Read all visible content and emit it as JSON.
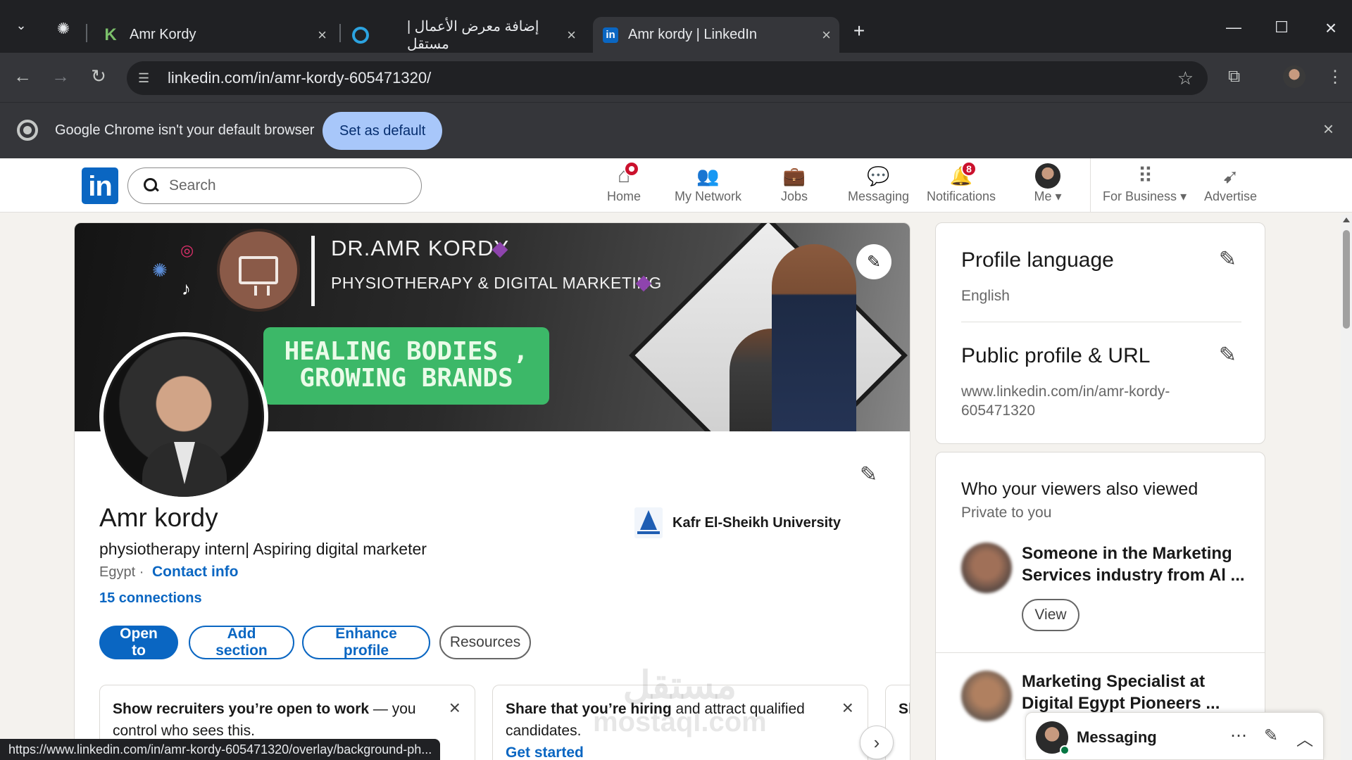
{
  "browser": {
    "tabs": [
      {
        "label": "Amr Kordy",
        "icon": "k-logo-icon"
      },
      {
        "label": "إضافة معرض الأعمال | مستقل",
        "icon": "mostaql-icon"
      },
      {
        "label": "Amr kordy | LinkedIn",
        "icon": "linkedin-icon"
      }
    ],
    "url": "linkedin.com/in/amr-kordy-605471320/",
    "infobar_message": "Google Chrome isn't your default browser",
    "set_default_label": "Set as default",
    "status_url": "https://www.linkedin.com/in/amr-kordy-605471320/overlay/background-ph..."
  },
  "header": {
    "search_placeholder": "Search",
    "nav": [
      {
        "label": "Home",
        "icon": "home-icon"
      },
      {
        "label": "My Network",
        "icon": "network-icon"
      },
      {
        "label": "Jobs",
        "icon": "briefcase-icon"
      },
      {
        "label": "Messaging",
        "icon": "chat-icon"
      },
      {
        "label": "Notifications",
        "icon": "bell-icon",
        "badge": "8"
      },
      {
        "label": "Me",
        "icon": "avatar"
      },
      {
        "label": "For Business",
        "icon": "grid-icon"
      },
      {
        "label": "Advertise",
        "icon": "compass-icon"
      }
    ]
  },
  "banner": {
    "title": "DR.AMR KORDY",
    "subtitle": "PHYSIOTHERAPY & DIGITAL MARKETING",
    "slogan_line1": "HEALING BODIES ,",
    "slogan_line2": "GROWING BRANDS",
    "accent": "#3cb868"
  },
  "profile": {
    "name": "Amr kordy",
    "headline": "physiotherapy intern| Aspiring digital marketer",
    "location": "Egypt",
    "contact_info": "Contact info",
    "connections": "15 connections",
    "education": "Kafr El-Sheikh University",
    "buttons": {
      "open_to": "Open to",
      "add_section": "Add section",
      "enhance_profile": "Enhance profile",
      "resources": "Resources"
    }
  },
  "promos": [
    {
      "bold": "Show recruiters you’re open to work",
      "rest": " — you control who sees this."
    },
    {
      "bold": "Share that you’re hiring",
      "rest": " and attract qualified candidates.",
      "link": "Get started"
    },
    {
      "bold": "Sh",
      "rest": "",
      "link": ""
    }
  ],
  "sidebar": {
    "profile_language_title": "Profile language",
    "profile_language_value": "English",
    "public_profile_title": "Public profile & URL",
    "public_profile_line1": "www.linkedin.com/in/amr-kordy-",
    "public_profile_line2": "605471320",
    "viewers_title": "Who your viewers also viewed",
    "viewers_sub": "Private to you",
    "viewers": [
      {
        "line1": "Someone in the Marketing",
        "line2": "Services industry from Al ...",
        "button": "View"
      },
      {
        "line1": "Marketing Specialist at",
        "line2": "Digital Egypt Pioneers ..."
      }
    ]
  },
  "messaging": {
    "title": "Messaging"
  },
  "watermark": {
    "line1": "مستقل",
    "line2": "mostaql.com"
  },
  "colors": {
    "linkedin_blue": "#0a66c2",
    "badge_red": "#cb112d",
    "chrome_dark": "#202124"
  }
}
